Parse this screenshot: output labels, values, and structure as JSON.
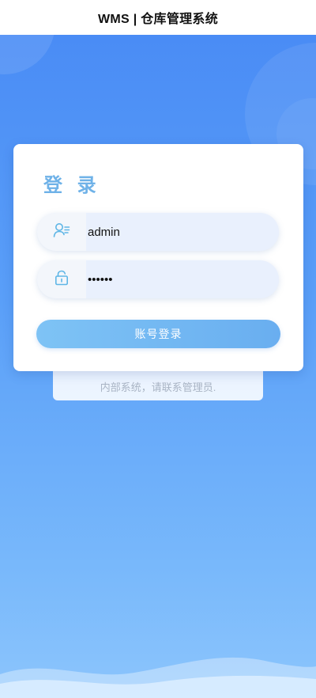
{
  "header": {
    "title": "WMS | 仓库管理系统"
  },
  "login": {
    "title": "登 录",
    "username": {
      "value": "admin",
      "icon": "user-icon"
    },
    "password": {
      "value": "••••••",
      "icon": "lock-icon"
    },
    "submit_label": "账号登录"
  },
  "notice": {
    "text": "内部系统，请联系管理员."
  },
  "colors": {
    "accent": "#6fb2e8",
    "background_top": "#4a8cf5",
    "background_bottom": "#8cc5fc",
    "button": "#74b9f3"
  }
}
